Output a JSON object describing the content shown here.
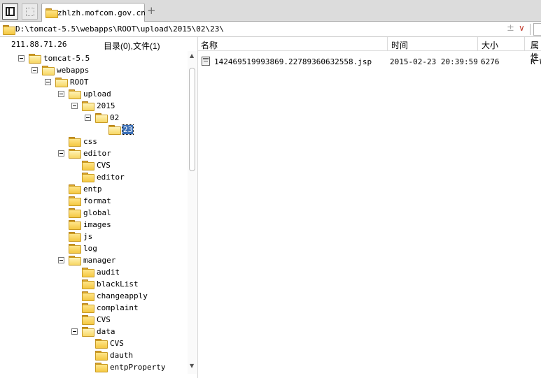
{
  "tab": {
    "title": "zhlzh.mofcom.gov.cn",
    "add_label": "+"
  },
  "path": {
    "value": "D:\\tomcat-5.5\\webapps\\ROOT\\upload\\2015\\02\\23\\",
    "add_label": "±",
    "dropdown_label": "∨"
  },
  "left_header": {
    "ip": "211.88.71.26",
    "counts": "目录(0),文件(1)"
  },
  "tree": [
    {
      "label": "tomcat-5.5",
      "expanded": true
    },
    {
      "label": "webapps",
      "expanded": true
    },
    {
      "label": "ROOT",
      "expanded": true
    },
    {
      "label": "upload",
      "expanded": true
    },
    {
      "label": "2015",
      "expanded": true
    },
    {
      "label": "02",
      "expanded": true
    },
    {
      "label": "23",
      "selected": true
    },
    {
      "label": "css"
    },
    {
      "label": "editor",
      "expanded": true
    },
    {
      "label": "CVS"
    },
    {
      "label": "editor"
    },
    {
      "label": "entp"
    },
    {
      "label": "format"
    },
    {
      "label": "global"
    },
    {
      "label": "images"
    },
    {
      "label": "js"
    },
    {
      "label": "log"
    },
    {
      "label": "manager",
      "expanded": true
    },
    {
      "label": "audit"
    },
    {
      "label": "blackList"
    },
    {
      "label": "changeapply"
    },
    {
      "label": "complaint"
    },
    {
      "label": "CVS"
    },
    {
      "label": "data",
      "expanded": true
    },
    {
      "label": "CVS"
    },
    {
      "label": "dauth"
    },
    {
      "label": "entpProperty"
    }
  ],
  "columns": {
    "name": "名称",
    "time": "时间",
    "size": "大小",
    "attr": "属性"
  },
  "files": [
    {
      "name": "142469519993869.22789360632558.jsp",
      "time": "2015-02-23 20:39:59",
      "size": "6276",
      "attr": "R W"
    }
  ],
  "icons": {
    "panel": "panel-toggle-icon",
    "blank": "blank-tab-icon",
    "folder": "folder-icon",
    "file": "file-icon"
  },
  "colors": {
    "selection": "#3b6fb6",
    "folder": "#f4c842",
    "dropdown": "#c0392b"
  }
}
